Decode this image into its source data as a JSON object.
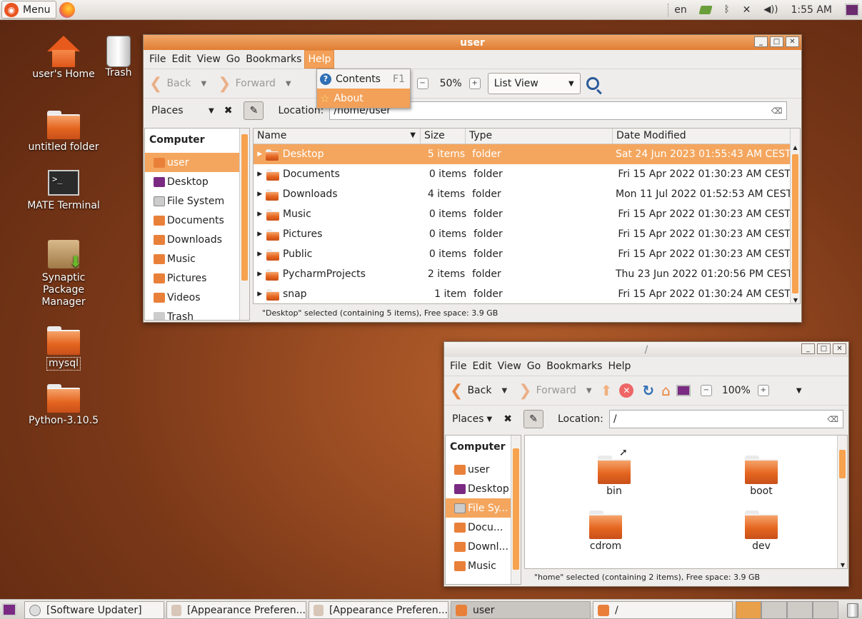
{
  "top_panel": {
    "menu_label": "Menu",
    "keyboard_layout": "en",
    "clock": "1:55 AM"
  },
  "desktop_icons": [
    {
      "label": "user's Home",
      "icon": "home-icon"
    },
    {
      "label": "Trash",
      "icon": "trash-icon"
    },
    {
      "label": "untitled folder",
      "icon": "folder-icon"
    },
    {
      "label": "MATE Terminal",
      "icon": "terminal-icon"
    },
    {
      "label": "Synaptic Package Manager",
      "icon": "package-icon"
    },
    {
      "label": "mysql",
      "icon": "folder-icon"
    },
    {
      "label": "Python-3.10.5",
      "icon": "folder-icon"
    }
  ],
  "window1": {
    "title": "user",
    "menus": [
      "File",
      "Edit",
      "View",
      "Go",
      "Bookmarks",
      "Help"
    ],
    "toolbar": {
      "back": "Back",
      "forward": "Forward",
      "zoom": "50%",
      "view_mode": "List View"
    },
    "places_label": "Places",
    "location_label": "Location:",
    "location_value": "/home/user",
    "help_menu": {
      "contents": "Contents",
      "contents_shortcut": "F1",
      "about": "About"
    },
    "sidebar": {
      "heading": "Computer",
      "items": [
        "user",
        "Desktop",
        "File System",
        "Documents",
        "Downloads",
        "Music",
        "Pictures",
        "Videos",
        "Trash"
      ]
    },
    "columns": [
      "Name",
      "Size",
      "Type",
      "Date Modified"
    ],
    "rows": [
      {
        "name": "Desktop",
        "size": "5 items",
        "type": "folder",
        "date": "Sat 24 Jun 2023 01:55:43 AM CEST"
      },
      {
        "name": "Documents",
        "size": "0 items",
        "type": "folder",
        "date": "Fri 15 Apr 2022 01:30:23 AM CEST"
      },
      {
        "name": "Downloads",
        "size": "4 items",
        "type": "folder",
        "date": "Mon 11 Jul 2022 01:52:53 AM CEST"
      },
      {
        "name": "Music",
        "size": "0 items",
        "type": "folder",
        "date": "Fri 15 Apr 2022 01:30:23 AM CEST"
      },
      {
        "name": "Pictures",
        "size": "0 items",
        "type": "folder",
        "date": "Fri 15 Apr 2022 01:30:23 AM CEST"
      },
      {
        "name": "Public",
        "size": "0 items",
        "type": "folder",
        "date": "Fri 15 Apr 2022 01:30:23 AM CEST"
      },
      {
        "name": "PycharmProjects",
        "size": "2 items",
        "type": "folder",
        "date": "Thu 23 Jun 2022 01:20:56 PM CEST"
      },
      {
        "name": "snap",
        "size": "1 item",
        "type": "folder",
        "date": "Fri 15 Apr 2022 01:30:24 AM CEST"
      }
    ],
    "status": "\"Desktop\" selected (containing 5 items), Free space: 3.9 GB"
  },
  "window2": {
    "title": "/",
    "menus": [
      "File",
      "Edit",
      "View",
      "Go",
      "Bookmarks",
      "Help"
    ],
    "toolbar": {
      "back": "Back",
      "forward": "Forward",
      "zoom": "100%"
    },
    "places_label": "Places",
    "location_label": "Location:",
    "location_value": "/",
    "sidebar": {
      "heading": "Computer",
      "items": [
        "user",
        "Desktop",
        "File Sy...",
        "Docu...",
        "Downl...",
        "Music"
      ]
    },
    "icons": [
      "bin",
      "boot",
      "cdrom",
      "dev"
    ],
    "status": "\"home\" selected (containing 2 items), Free space: 3.9 GB"
  },
  "taskbar": [
    {
      "label": "[Software Updater]"
    },
    {
      "label": "[Appearance Preferen..."
    },
    {
      "label": "[Appearance Preferen..."
    },
    {
      "label": "user"
    },
    {
      "label": "/"
    }
  ]
}
